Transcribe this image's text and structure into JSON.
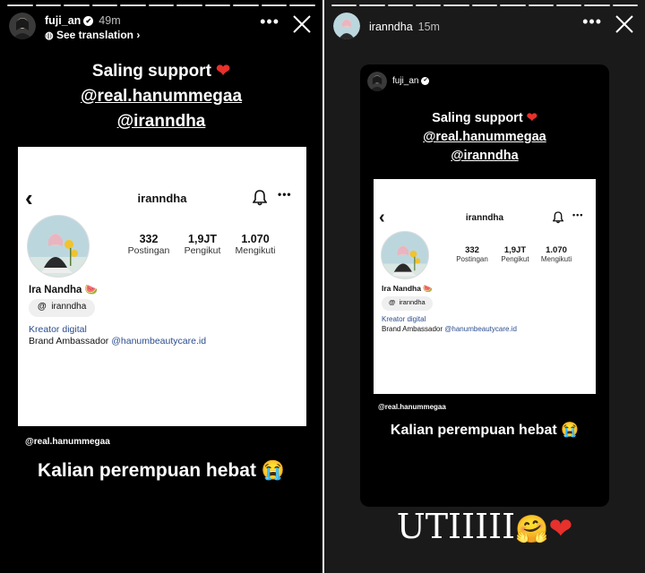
{
  "left_story": {
    "username": "fuji_an",
    "time": "49m",
    "see_translation": "See translation",
    "caption_line1": "Saling support",
    "caption_mention1": "@real.hanummegaa",
    "caption_mention2": "@iranndha",
    "mention_tag": "@real.hanummegaa",
    "bottom_caption": "Kalian perempuan hebat",
    "bottom_emoji": "😭"
  },
  "right_story": {
    "username": "iranndha",
    "time": "15m",
    "inner_username": "fuji_an",
    "reply_text": "UTIIIII",
    "reply_emoji1": "🤗",
    "reply_emoji2": "❤"
  },
  "profile": {
    "username": "iranndha",
    "posts_count": "332",
    "posts_label": "Postingan",
    "followers_count": "1,9JT",
    "followers_label": "Pengikut",
    "following_count": "1.070",
    "following_label": "Mengikuti",
    "display_name": "Ira Nandha",
    "name_emoji": "🍉",
    "threads_handle": "iranndha",
    "category": "Kreator digital",
    "bio_prefix": "Brand Ambassador",
    "bio_mention": "@hanumbeautycare.id"
  },
  "icons": {
    "heart": "❤",
    "more": "•••",
    "close": "✕",
    "back": "‹",
    "bell": "bell-icon",
    "verified": "✔",
    "chevron": "›",
    "threads": "@"
  },
  "colors": {
    "heart": "#e8302c",
    "link": "#2b4d8e",
    "right_bg": "#1a1a1a"
  }
}
